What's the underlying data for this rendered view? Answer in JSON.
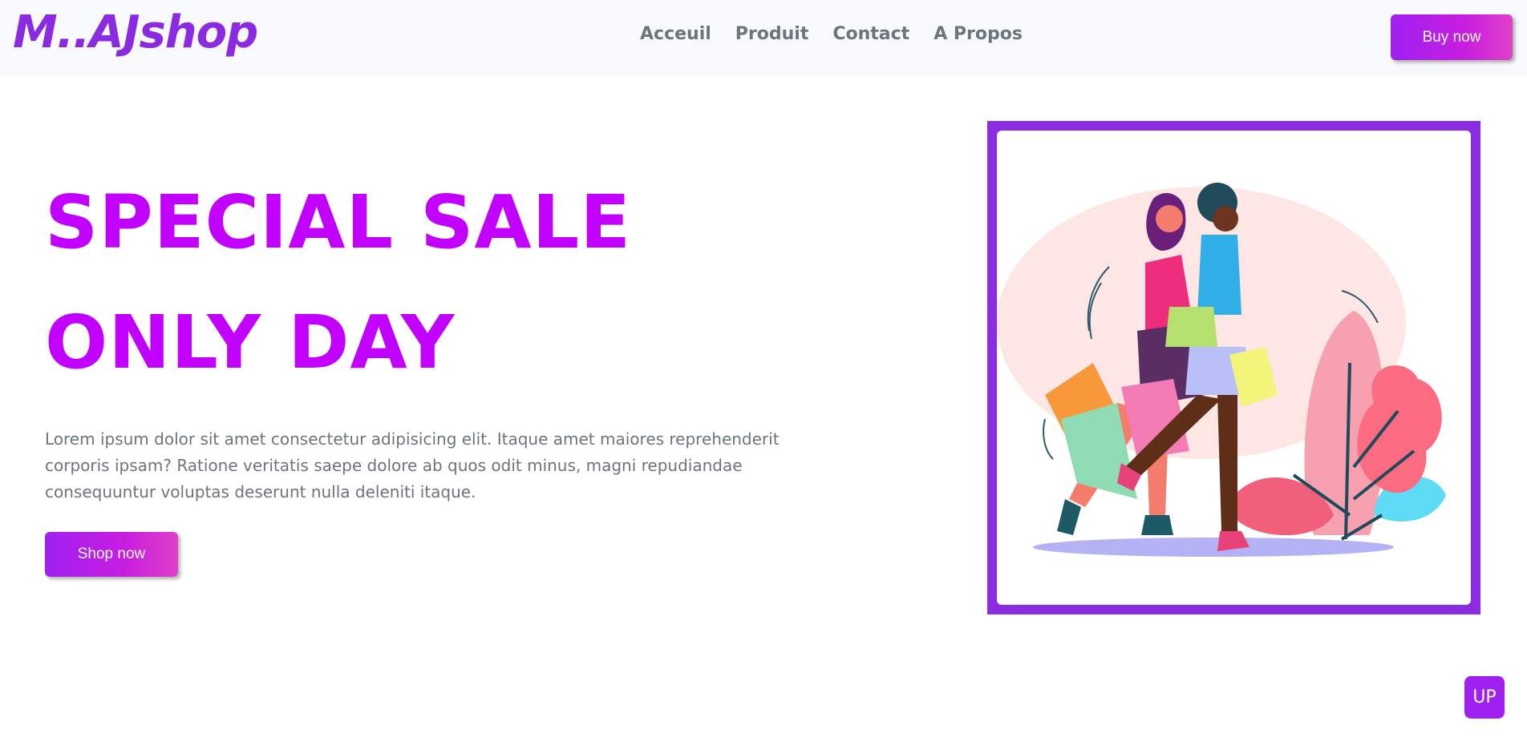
{
  "navbar": {
    "brand": "M..AJshop",
    "links": [
      "Acceuil",
      "Produit",
      "Contact",
      "A Propos"
    ],
    "cta_label": "Buy now"
  },
  "hero": {
    "title_line1": "SPECIAL SALE",
    "title_line2": "ONLY DAY",
    "text": "Lorem ipsum dolor sit amet consectetur adipisicing elit. Itaque amet maiores reprehenderit corporis ipsam? Ratione veritatis saepe dolore ab quos odit minus, magni repudiandae consequuntur voluptas deserunt nulla deleniti itaque.",
    "button_label": "Shop now",
    "illustration": "two-women-shopping-illustration"
  },
  "scroll_top": {
    "label": "UP"
  },
  "colors": {
    "brand": "#8a2be2",
    "title": "#c100ff",
    "frame": "#8b2be2",
    "button_gradient": [
      "#a020f0",
      "#e040c8"
    ]
  }
}
